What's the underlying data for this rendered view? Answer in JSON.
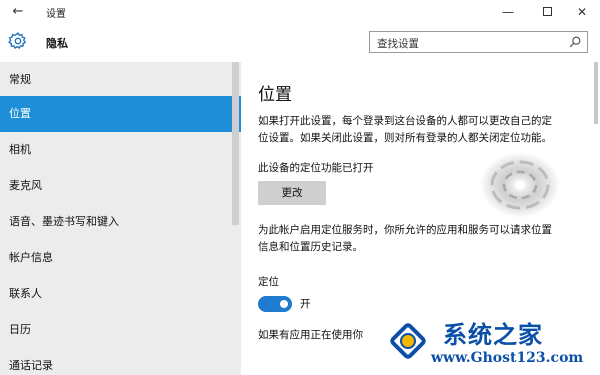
{
  "window": {
    "back_glyph": "←",
    "title": "设置",
    "minimize_glyph": "—",
    "close_glyph": "✕"
  },
  "header": {
    "icon": "gear-icon",
    "page_title": "隐私",
    "search_placeholder": "查找设置",
    "search_icon": "search-icon"
  },
  "sidebar": {
    "items": [
      {
        "label": "常规",
        "active": false
      },
      {
        "label": "位置",
        "active": true
      },
      {
        "label": "相机",
        "active": false
      },
      {
        "label": "麦克风",
        "active": false
      },
      {
        "label": "语音、墨迹书写和键入",
        "active": false
      },
      {
        "label": "帐户信息",
        "active": false
      },
      {
        "label": "联系人",
        "active": false
      },
      {
        "label": "日历",
        "active": false
      },
      {
        "label": "通话记录",
        "active": false
      }
    ]
  },
  "content": {
    "title": "位置",
    "para1_line1": "如果打开此设置，每个登录到这台设备的人都可以更改自己的定",
    "para1_line2": "位设置。如果关闭此设置，则对所有登录的人都关闭定位功能。",
    "status_text": "此设备的定位功能已打开",
    "change_button": "更改",
    "para2_line1": "为此帐户启用定位服务时，你所允许的应用和服务可以请求位置",
    "para2_line2": "信息和位置历史记录。",
    "location_label": "定位",
    "toggle_state": "开",
    "toggle_on": true,
    "truncated_text": "如果有应用正在使用你"
  },
  "watermark": {
    "brand": "系统之家",
    "url": "www.Ghost123.com"
  },
  "colors": {
    "accent": "#1e8fd6",
    "toggle": "#1e7bd0",
    "sidebar_bg": "#ececec",
    "watermark": "#0b4fa8"
  }
}
